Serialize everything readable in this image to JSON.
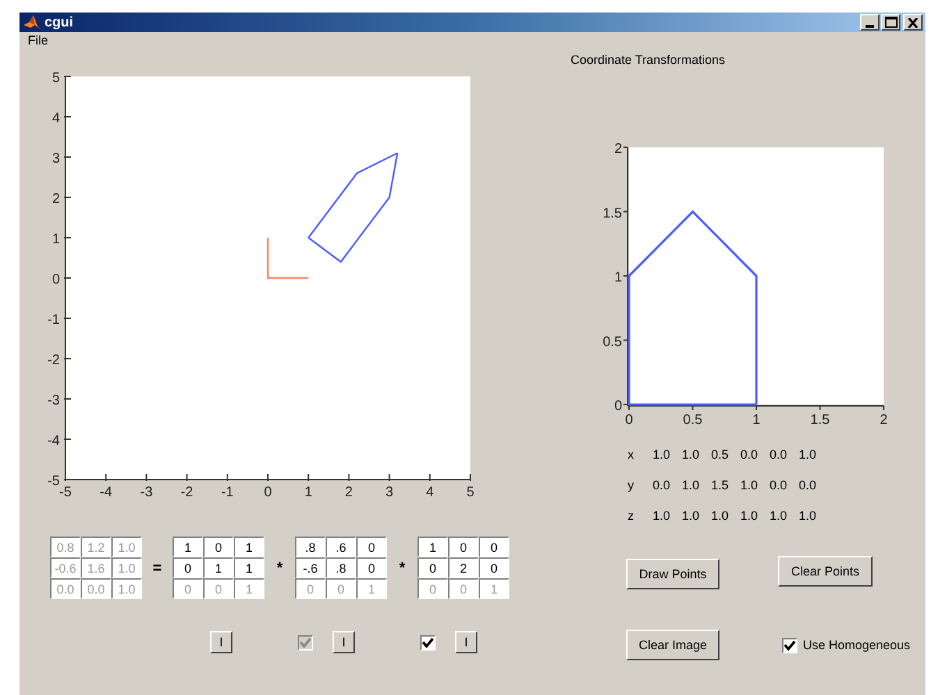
{
  "window": {
    "title": "cgui"
  },
  "menu": [
    "File"
  ],
  "heading": "Coordinate Transformations",
  "plots": [
    {
      "chart_data": {
        "type": "line",
        "xlim": [
          -5,
          5
        ],
        "ylim": [
          -5,
          5
        ],
        "xticks": [
          -5,
          -4,
          -3,
          -2,
          -1,
          0,
          1,
          2,
          3,
          4,
          5
        ],
        "yticks": [
          -5,
          -4,
          -3,
          -2,
          -1,
          0,
          1,
          2,
          3,
          4,
          5
        ],
        "series": [
          {
            "color": "#4d5cff",
            "x": [
              1,
              1.8,
              3,
              3.2
            ],
            "values": [
              1,
              0.4,
              2,
              3.1
            ]
          },
          {
            "color": "#4d5cff",
            "x": [
              1,
              2.2,
              3.2
            ],
            "values": [
              1,
              2.6,
              3.1
            ]
          },
          {
            "color": "#ff8060",
            "x": [
              0,
              0,
              1
            ],
            "values": [
              1,
              0,
              0
            ]
          }
        ]
      }
    },
    {
      "chart_data": {
        "type": "line",
        "xlim": [
          0,
          2
        ],
        "ylim": [
          0,
          2
        ],
        "xticks": [
          0,
          0.5,
          1,
          1.5,
          2
        ],
        "yticks": [
          0,
          0.5,
          1,
          1.5,
          2
        ],
        "series": [
          {
            "color": "#4d5cff",
            "x": [
              0,
              0,
              0.5,
              1,
              1
            ],
            "values": [
              0,
              1,
              1.5,
              1,
              0
            ]
          },
          {
            "color": "#4d5cff",
            "x": [
              0,
              1
            ],
            "values": [
              0,
              0
            ]
          }
        ]
      }
    }
  ],
  "points": [
    {
      "label": "x",
      "values": [
        "1.0",
        "1.0",
        "0.5",
        "0.0",
        "0.0",
        "1.0"
      ]
    },
    {
      "label": "y",
      "values": [
        "0.0",
        "1.0",
        "1.5",
        "1.0",
        "0.0",
        "0.0"
      ]
    },
    {
      "label": "z",
      "values": [
        "1.0",
        "1.0",
        "1.0",
        "1.0",
        "1.0",
        "1.0"
      ]
    }
  ],
  "matrices": [
    {
      "rows": [
        {
          "disabled": true,
          "cells": [
            "0.8",
            "1.2",
            "1.0"
          ]
        },
        {
          "disabled": true,
          "cells": [
            "-0.6",
            "1.6",
            "1.0"
          ]
        },
        {
          "disabled": true,
          "cells": [
            "0.0",
            "0.0",
            "1.0"
          ]
        }
      ]
    },
    {
      "operator": "=",
      "rows": [
        {
          "disabled": false,
          "cells": [
            "1",
            "0",
            "1"
          ]
        },
        {
          "disabled": false,
          "cells": [
            "0",
            "1",
            "1"
          ]
        },
        {
          "disabled": true,
          "cells": [
            "0",
            "0",
            "1"
          ]
        }
      ]
    },
    {
      "operator": "*",
      "rows": [
        {
          "disabled": false,
          "cells": [
            ".8",
            ".6",
            "0"
          ]
        },
        {
          "disabled": false,
          "cells": [
            "-.6",
            ".8",
            "0"
          ]
        },
        {
          "disabled": true,
          "cells": [
            "0",
            "0",
            "1"
          ]
        }
      ]
    },
    {
      "operator": "*",
      "rows": [
        {
          "disabled": false,
          "cells": [
            "1",
            "0",
            "0"
          ]
        },
        {
          "disabled": false,
          "cells": [
            "0",
            "2",
            "0"
          ]
        },
        {
          "disabled": true,
          "cells": [
            "0",
            "0",
            "1"
          ]
        }
      ]
    }
  ],
  "transform_controls": [
    {
      "button": "I"
    },
    {
      "checkbox": {
        "checked": true,
        "disabled": true
      },
      "button": "I"
    },
    {
      "checkbox": {
        "checked": true,
        "disabled": false
      },
      "button": "I"
    }
  ],
  "buttons": [
    "Draw Points",
    "Clear Points",
    "Clear Image"
  ],
  "homogeneous": {
    "label": "Use Homogeneous",
    "checked": true
  }
}
